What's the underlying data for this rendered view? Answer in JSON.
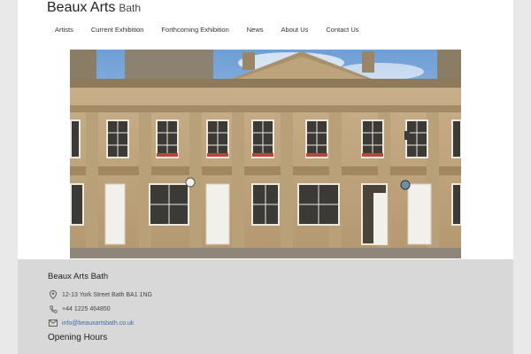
{
  "brand": {
    "name": "Beaux Arts",
    "suffix": "Bath"
  },
  "nav": {
    "items": [
      "Artists",
      "Current Exhibition",
      "Forthcoming Exhibition",
      "News",
      "About Us",
      "Contact Us"
    ]
  },
  "hero": {
    "alt": "Georgian stone building facade on York Street, Bath"
  },
  "footer": {
    "title": "Beaux Arts Bath",
    "address": "12-13 York Street Bath BA1 1NG",
    "phone": "+44 1225 464850",
    "email": "info@beauxartsbath.co.uk",
    "hours_title": "Opening Hours"
  },
  "icons": {
    "address": "map-pin-icon",
    "phone": "phone-icon",
    "email": "envelope-icon"
  },
  "colors": {
    "page": "#ffffff",
    "background": "#e9e9e9",
    "footer": "#d8d8d8",
    "link": "#3a6fb0"
  }
}
